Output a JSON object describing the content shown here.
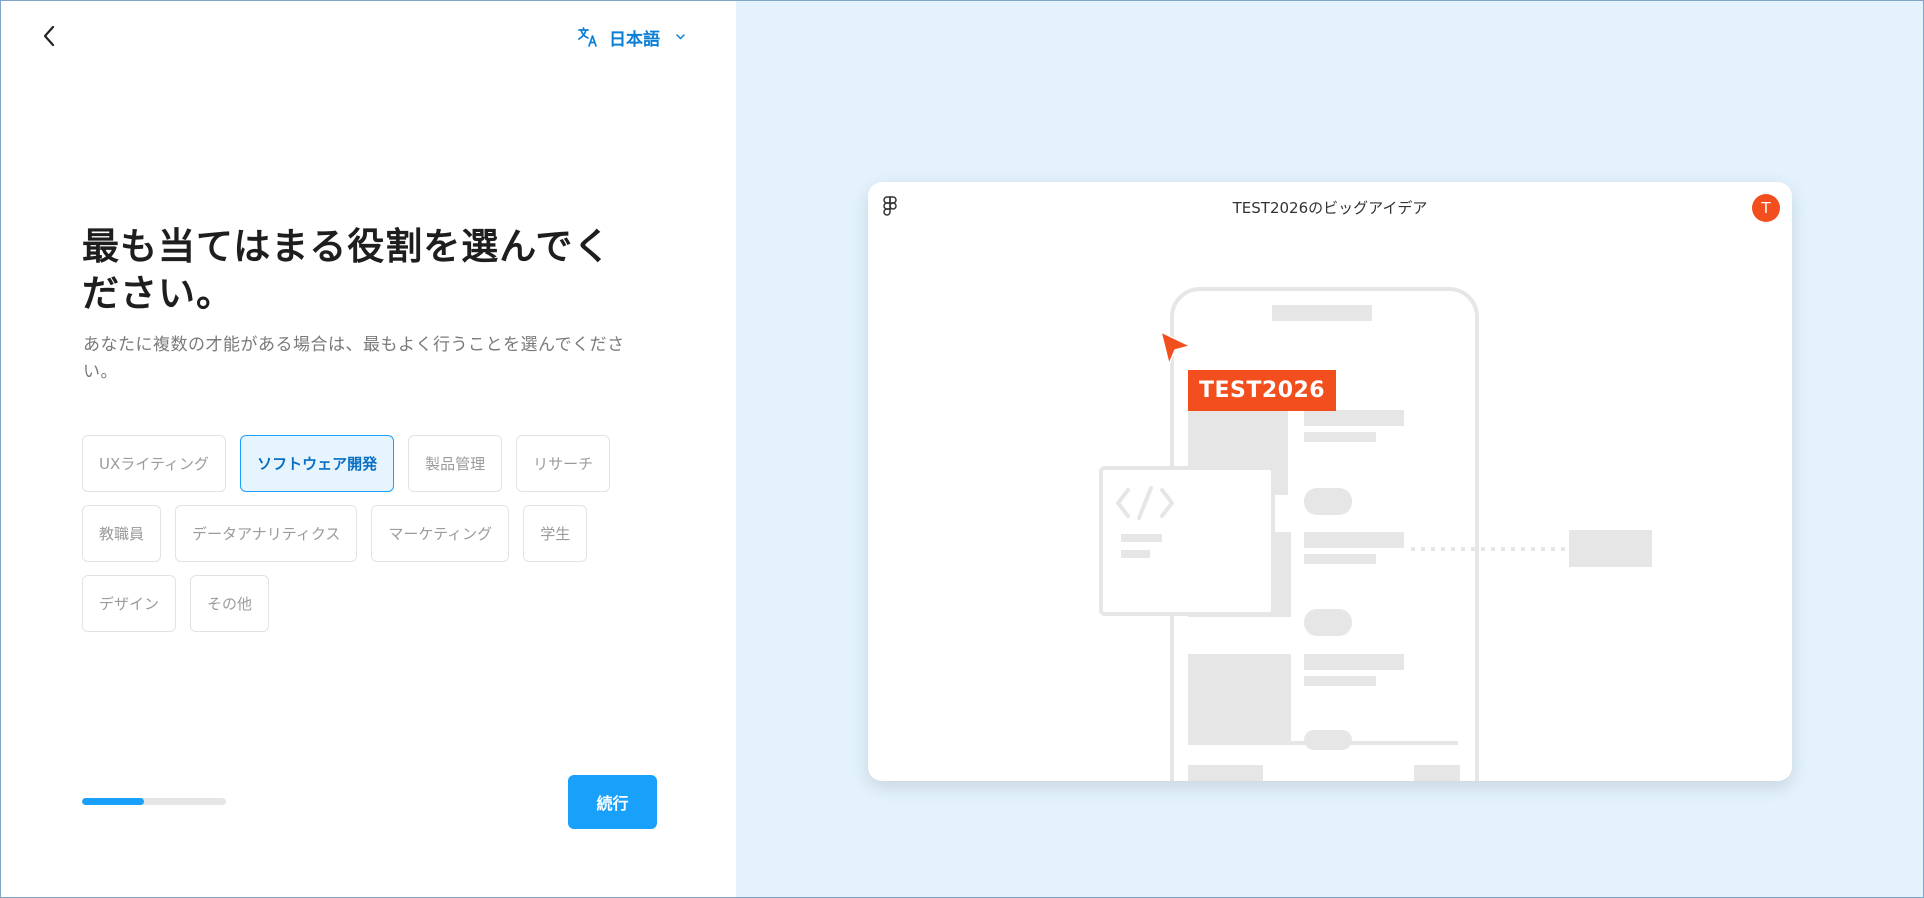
{
  "header": {
    "back_icon": "chevron-left-icon",
    "language_icon": "translate-icon",
    "language_label": "日本語",
    "language_chevron": "chevron-down-icon"
  },
  "main": {
    "title": "最も当てはまる役割を選んでください。",
    "subtitle": "あなたに複数の才能がある場合は、最もよく行うことを選んでください。",
    "roles": [
      {
        "label": "UXライティング",
        "selected": false
      },
      {
        "label": "ソフトウェア開発",
        "selected": true
      },
      {
        "label": "製品管理",
        "selected": false
      },
      {
        "label": "リサーチ",
        "selected": false
      },
      {
        "label": "教職員",
        "selected": false
      },
      {
        "label": "データアナリティクス",
        "selected": false
      },
      {
        "label": "マーケティング",
        "selected": false
      },
      {
        "label": "学生",
        "selected": false
      },
      {
        "label": "デザイン",
        "selected": false
      },
      {
        "label": "その他",
        "selected": false
      }
    ],
    "progress_fraction": 0.43,
    "continue_label": "続行"
  },
  "preview": {
    "file_title": "TEST2026のビッグアイデア",
    "avatar_initial": "T",
    "cursor_label": "TEST2026",
    "cursor_color": "#f24e1e",
    "code_symbol": "</>"
  },
  "colors": {
    "accent": "#18a0fb",
    "accent_text": "#0a7fd6",
    "right_bg": "#e3f2fd",
    "illustration_gray": "#e6e6e6"
  }
}
